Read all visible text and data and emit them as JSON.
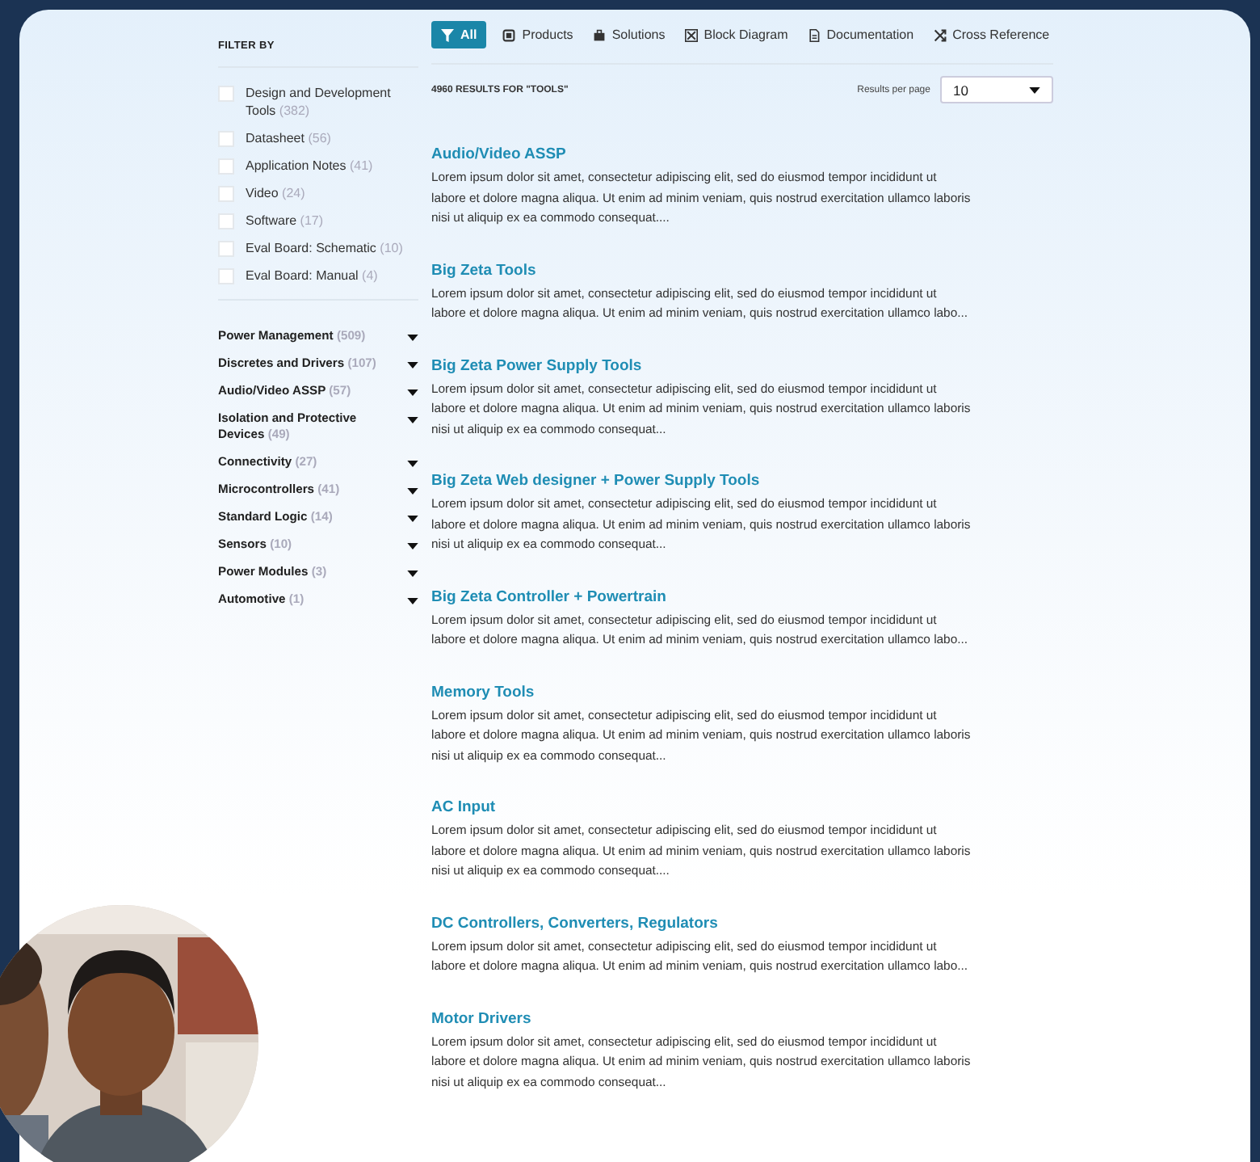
{
  "filter": {
    "title": "FILTER BY",
    "options": [
      {
        "label": "Design and Development Tools",
        "count": "(382)",
        "checked": false
      },
      {
        "label": "Datasheet",
        "count": "(56)",
        "checked": false
      },
      {
        "label": "Application Notes",
        "count": "(41)",
        "checked": false
      },
      {
        "label": "Video",
        "count": "(24)",
        "checked": false
      },
      {
        "label": "Software",
        "count": "(17)",
        "checked": false
      },
      {
        "label": "Eval Board: Schematic",
        "count": "(10)",
        "checked": false
      },
      {
        "label": "Eval Board: Manual",
        "count": "(4)",
        "checked": false
      }
    ],
    "categories": [
      {
        "label": "Power Management",
        "count": "(509)",
        "expanded": false
      },
      {
        "label": "Discretes and Drivers",
        "count": "(107)",
        "expanded": false
      },
      {
        "label": "Audio/Video ASSP",
        "count": "(57)",
        "expanded": false
      },
      {
        "label": "Isolation and Protective Devices",
        "count": "(49)",
        "expanded": false
      },
      {
        "label": "Connectivity",
        "count": "(27)",
        "expanded": false
      },
      {
        "label": "Microcontrollers",
        "count": "(41)",
        "expanded": false
      },
      {
        "label": "Standard Logic",
        "count": "(14)",
        "expanded": false
      },
      {
        "label": "Sensors",
        "count": "(10)",
        "expanded": false
      },
      {
        "label": "Power Modules",
        "count": "(3)",
        "expanded": false
      },
      {
        "label": "Automotive",
        "count": "(1)",
        "expanded": false
      }
    ]
  },
  "tabs": [
    {
      "label": "All",
      "kind": "filter",
      "selected": true
    },
    {
      "label": "Products",
      "kind": "products",
      "selected": false
    },
    {
      "label": "Solutions",
      "kind": "solutions",
      "selected": false
    },
    {
      "label": "Block Diagram",
      "kind": "diagram",
      "selected": false
    },
    {
      "label": "Documentation",
      "kind": "document",
      "selected": false
    },
    {
      "label": "Cross Reference",
      "kind": "cross",
      "selected": false
    }
  ],
  "summary": "4960 RESULTS FOR \"TOOLS\"",
  "per_page": {
    "label": "Results per page",
    "value": "10"
  },
  "results": [
    {
      "title": "Audio/Video ASSP",
      "text": "Lorem ipsum dolor sit amet, consectetur adipiscing elit, sed do eiusmod tempor incididunt ut labore et dolore magna aliqua. Ut enim ad minim veniam, quis nostrud exercitation ullamco laboris nisi ut aliquip ex ea commodo consequat...."
    },
    {
      "title": "Big Zeta Tools",
      "text": "Lorem ipsum dolor sit amet, consectetur adipiscing elit, sed do eiusmod tempor incididunt ut labore et dolore magna aliqua. Ut enim ad minim veniam, quis nostrud exercitation ullamco labo..."
    },
    {
      "title": "Big Zeta Power Supply Tools",
      "text": "Lorem ipsum dolor sit amet, consectetur adipiscing elit, sed do eiusmod tempor incididunt ut labore et dolore magna aliqua. Ut enim ad minim veniam, quis nostrud exercitation ullamco laboris nisi ut aliquip ex ea commodo consequat..."
    },
    {
      "title": "Big Zeta Web designer + Power Supply Tools",
      "text": "Lorem ipsum dolor sit amet, consectetur adipiscing elit, sed do eiusmod tempor incididunt ut labore et dolore magna aliqua. Ut enim ad minim veniam, quis nostrud exercitation ullamco laboris nisi ut aliquip ex ea commodo consequat..."
    },
    {
      "title": "Big Zeta Controller + Powertrain",
      "text": "Lorem ipsum dolor sit amet, consectetur adipiscing elit, sed do eiusmod tempor incididunt ut labore et dolore magna aliqua. Ut enim ad minim veniam, quis nostrud exercitation ullamco labo..."
    },
    {
      "title": "Memory Tools",
      "text": "Lorem ipsum dolor sit amet, consectetur adipiscing elit, sed do eiusmod tempor incididunt ut labore et dolore magna aliqua. Ut enim ad minim veniam, quis nostrud exercitation ullamco laboris nisi ut aliquip ex ea commodo consequat..."
    },
    {
      "title": "AC Input",
      "text": "Lorem ipsum dolor sit amet, consectetur adipiscing elit, sed do eiusmod tempor incididunt ut labore et dolore magna aliqua. Ut enim ad minim veniam, quis nostrud exercitation ullamco laboris nisi ut aliquip ex ea commodo consequat...."
    },
    {
      "title": "DC Controllers, Converters, Regulators",
      "text": "Lorem ipsum dolor sit amet, consectetur adipiscing elit, sed do eiusmod tempor incididunt ut labore et dolore magna aliqua. Ut enim ad minim veniam, quis nostrud exercitation ullamco labo..."
    },
    {
      "title": "Motor Drivers",
      "text": "Lorem ipsum dolor sit amet, consectetur adipiscing elit, sed do eiusmod tempor incididunt ut labore et dolore magna aliqua. Ut enim ad minim veniam, quis nostrud exercitation ullamco laboris nisi ut aliquip ex ea commodo consequat..."
    }
  ]
}
